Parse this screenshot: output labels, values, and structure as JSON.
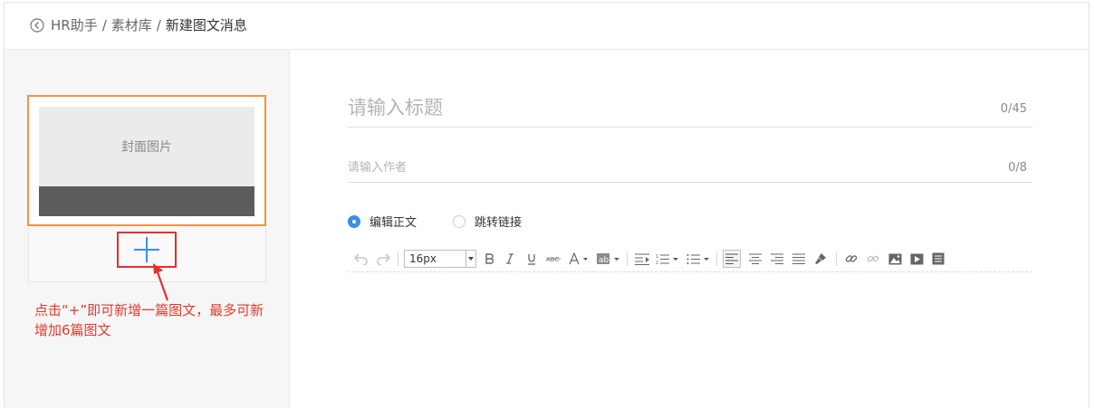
{
  "breadcrumb": {
    "items": [
      "HR助手",
      "素材库"
    ],
    "separator": "/",
    "current": "新建图文消息"
  },
  "sidebar": {
    "cover_label": "封面图片",
    "annotation": "点击“+”即可新增一篇图文，最多可新增加6篇图文"
  },
  "editor": {
    "title_placeholder": "请输入标题",
    "title_counter": "0/45",
    "author_placeholder": "请输入作者",
    "author_counter": "0/8",
    "mode_options": [
      {
        "label": "编辑正文",
        "checked": true
      },
      {
        "label": "跳转链接",
        "checked": false
      }
    ],
    "font_size": "16px"
  },
  "toolbar_icons": [
    "undo-icon",
    "redo-icon",
    "bold-icon",
    "italic-icon",
    "underline-icon",
    "strikethrough-icon",
    "font-color-icon",
    "background-color-icon",
    "indent-icon",
    "ordered-list-icon",
    "unordered-list-icon",
    "align-left-icon",
    "align-center-icon",
    "align-right-icon",
    "justify-icon",
    "format-brush-icon",
    "link-icon",
    "unlink-icon",
    "image-icon",
    "video-icon",
    "template-icon"
  ],
  "colors": {
    "accent": "#3c8ee7",
    "selected_card": "#f5923e",
    "annotation": "#e23a2c"
  }
}
